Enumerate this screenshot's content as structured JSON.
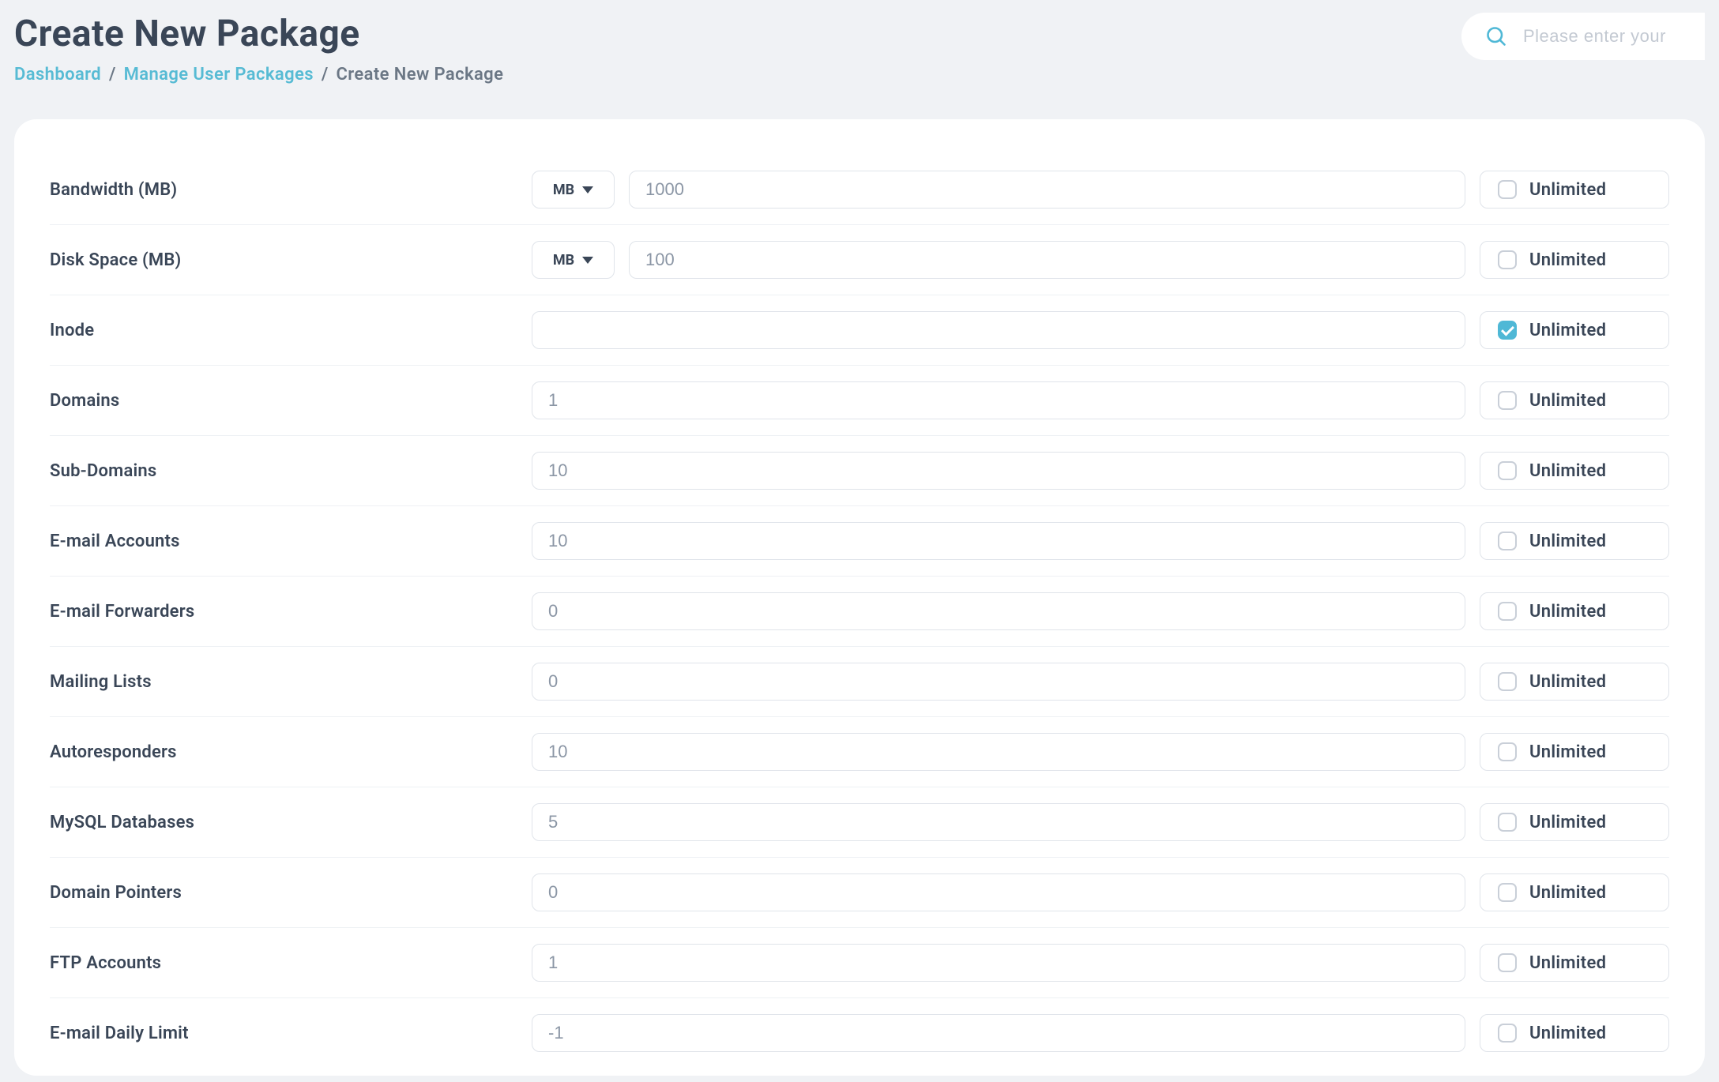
{
  "header": {
    "title": "Create New Package",
    "breadcrumb": {
      "dashboard": "Dashboard",
      "manage": "Manage User Packages",
      "current": "Create New Package"
    }
  },
  "search": {
    "placeholder": "Please enter your"
  },
  "unlimited_label": "Unlimited",
  "unit_mb": "MB",
  "fields": {
    "bandwidth": {
      "label": "Bandwidth (MB)",
      "value": "1000",
      "unit": true,
      "unlimited": false
    },
    "diskspace": {
      "label": "Disk Space (MB)",
      "value": "100",
      "unit": true,
      "unlimited": false
    },
    "inode": {
      "label": "Inode",
      "value": "",
      "unit": false,
      "unlimited": true
    },
    "domains": {
      "label": "Domains",
      "value": "1",
      "unit": false,
      "unlimited": false
    },
    "subdomains": {
      "label": "Sub-Domains",
      "value": "10",
      "unit": false,
      "unlimited": false
    },
    "email_accounts": {
      "label": "E-mail Accounts",
      "value": "10",
      "unit": false,
      "unlimited": false
    },
    "email_fwd": {
      "label": "E-mail Forwarders",
      "value": "0",
      "unit": false,
      "unlimited": false
    },
    "mailing_lists": {
      "label": "Mailing Lists",
      "value": "0",
      "unit": false,
      "unlimited": false
    },
    "autoresponders": {
      "label": "Autoresponders",
      "value": "10",
      "unit": false,
      "unlimited": false
    },
    "mysql": {
      "label": "MySQL Databases",
      "value": "5",
      "unit": false,
      "unlimited": false
    },
    "pointers": {
      "label": "Domain Pointers",
      "value": "0",
      "unit": false,
      "unlimited": false
    },
    "ftp": {
      "label": "FTP Accounts",
      "value": "1",
      "unit": false,
      "unlimited": false
    },
    "email_daily": {
      "label": "E-mail Daily Limit",
      "value": "-1",
      "unit": false,
      "unlimited": false
    }
  },
  "field_order": [
    "bandwidth",
    "diskspace",
    "inode",
    "domains",
    "subdomains",
    "email_accounts",
    "email_fwd",
    "mailing_lists",
    "autoresponders",
    "mysql",
    "pointers",
    "ftp",
    "email_daily"
  ]
}
